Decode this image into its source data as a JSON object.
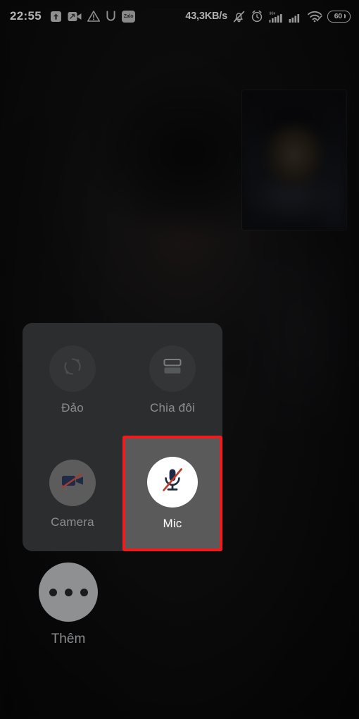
{
  "status_bar": {
    "clock": "22:55",
    "network_speed": "43,3KB/s",
    "battery_level": "60",
    "left_icons": [
      {
        "name": "upload-arrow-icon",
        "glyph": "↑"
      },
      {
        "name": "screen-record-video-icon",
        "glyph": "↗"
      },
      {
        "name": "warning-triangle-icon",
        "glyph": "!"
      },
      {
        "name": "magnet-u-icon",
        "glyph": "U"
      },
      {
        "name": "zalo-app-icon",
        "glyph": "Zalo"
      }
    ],
    "right_icons": [
      {
        "name": "mute-bell-icon",
        "glyph": "✗"
      },
      {
        "name": "alarm-clock-icon",
        "glyph": "⏰"
      },
      {
        "name": "signal-hplus-icon",
        "glyph": "H+"
      },
      {
        "name": "signal-bars-icon",
        "glyph": "█"
      },
      {
        "name": "wifi-icon",
        "glyph": "◠"
      }
    ]
  },
  "call": {
    "self_view_label": "self-view-thumbnail"
  },
  "control_panel": {
    "tiles": [
      {
        "name": "flip-camera",
        "label": "Đảo",
        "icon": "rotate-camera-icon",
        "selected": false,
        "disabled_look": true
      },
      {
        "name": "split-screen",
        "label": "Chia đôi",
        "icon": "split-screen-icon",
        "selected": false,
        "disabled_look": true
      },
      {
        "name": "camera",
        "label": "Camera",
        "icon": "camera-off-icon",
        "selected": false,
        "disabled_look": false
      },
      {
        "name": "mic",
        "label": "Mic",
        "icon": "mic-off-icon",
        "selected": true,
        "disabled_look": false
      }
    ]
  },
  "more_button": {
    "label": "Thêm",
    "icon": "more-dots-icon"
  },
  "colors": {
    "highlight": "#ee1c1c",
    "panel_bg": "#2b2d2e",
    "selected_tile_bg": "#5a5a5a",
    "icon_navy": "#1e2a46",
    "slash_red": "#c0392b"
  }
}
